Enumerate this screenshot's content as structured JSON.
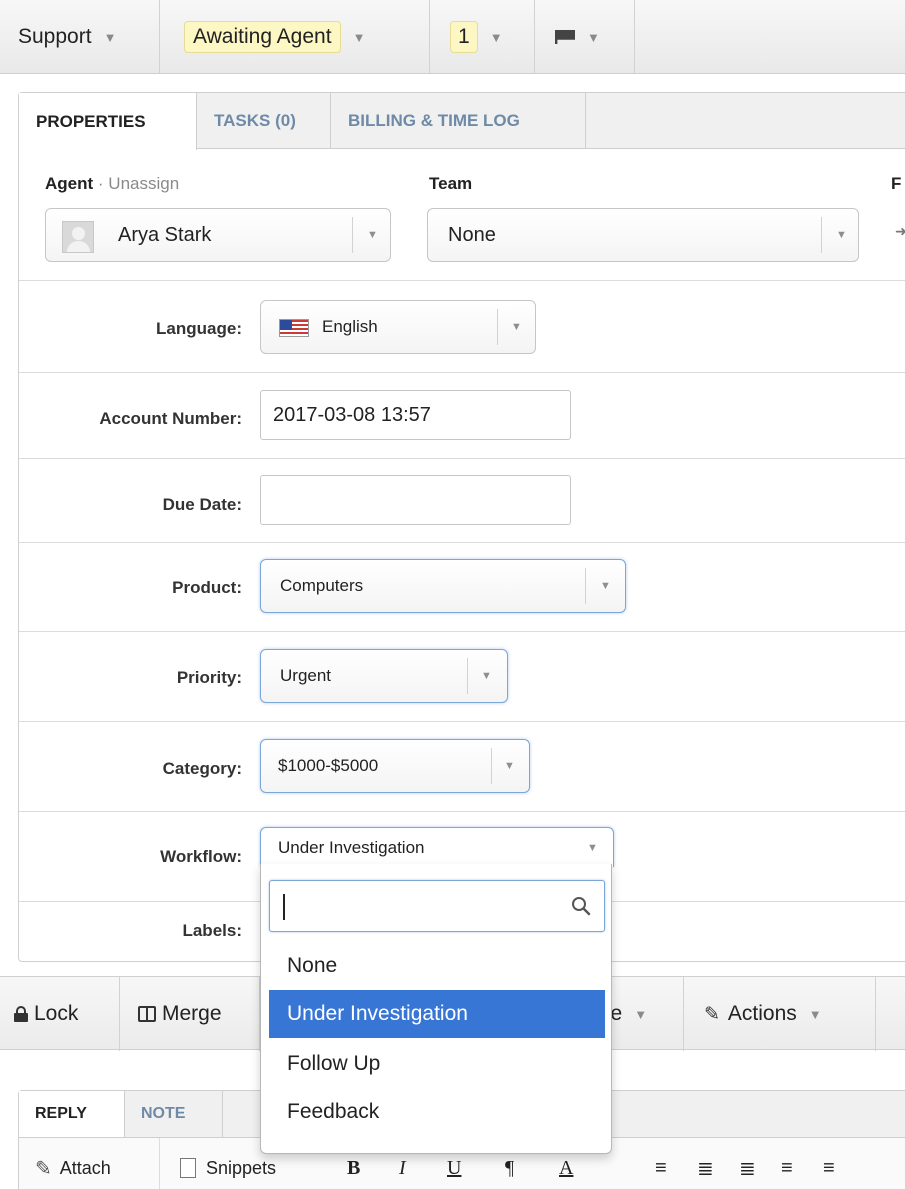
{
  "topbar": {
    "department": "Support",
    "status": "Awaiting Agent",
    "urgency": "1",
    "flag_icon": "flag-icon"
  },
  "tabs": [
    "PROPERTIES",
    "TASKS (0)",
    "BILLING & TIME LOG"
  ],
  "agent": {
    "label": "Agent",
    "unassign": "· Unassign",
    "value": "Arya Stark",
    "avatar_icon": "avatar-placeholder-icon"
  },
  "team": {
    "label": "Team",
    "value": "None"
  },
  "followers": {
    "label_fragment": "F"
  },
  "fields": {
    "language": {
      "label": "Language:",
      "value": "English",
      "flag": "us-flag-icon"
    },
    "account_number": {
      "label": "Account Number:",
      "value": "2017-03-08 13:57"
    },
    "due_date": {
      "label": "Due Date:",
      "value": ""
    },
    "product": {
      "label": "Product:",
      "value": "Computers"
    },
    "priority": {
      "label": "Priority:",
      "value": "Urgent"
    },
    "category": {
      "label": "Category:",
      "value": "$1000-$5000"
    },
    "workflow": {
      "label": "Workflow:",
      "value": "Under Investigation"
    },
    "labels": {
      "label": "Labels:"
    }
  },
  "workflow_dropdown": {
    "search_value": "",
    "options": [
      "None",
      "Under Investigation",
      "Follow Up",
      "Feedback"
    ],
    "highlighted": "Under Investigation"
  },
  "actionbar": {
    "lock": "Lock",
    "merge": "Merge",
    "move_fragment": "ve",
    "actions": "Actions"
  },
  "reply": {
    "tabs": [
      "REPLY",
      "NOTE"
    ],
    "attach": "Attach",
    "snippets": "Snippets",
    "format": {
      "bold": "B",
      "italic": "I",
      "underline": "U",
      "paragraph": "¶",
      "color": "A"
    }
  },
  "colors": {
    "highlight": "#3876d6",
    "status_pill": "#fdf7c3",
    "tab_link": "#6e8aa7",
    "focus_border": "#7aa6d8"
  }
}
